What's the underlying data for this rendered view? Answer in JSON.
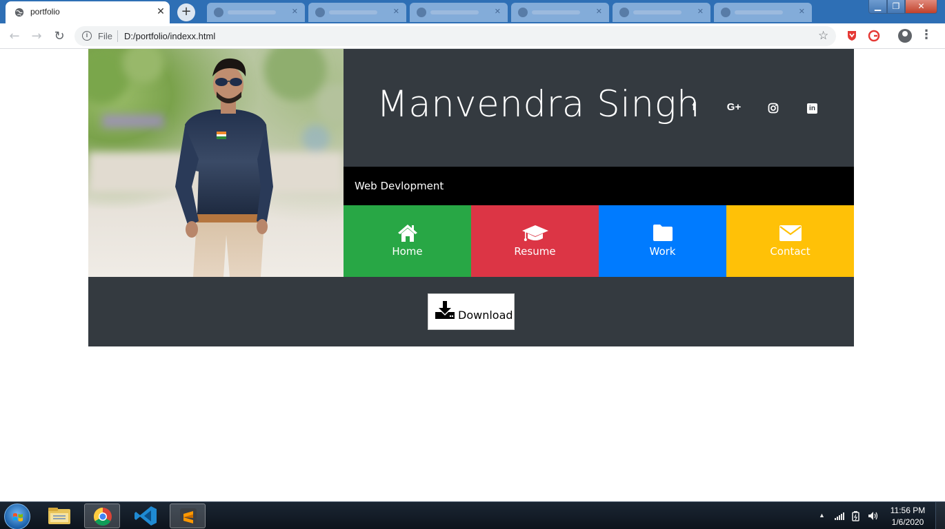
{
  "browser": {
    "active_tab": {
      "title": "portfolio",
      "close": "✕"
    },
    "new_tab": "+",
    "window_controls": {
      "minimize": "▁",
      "maximize": "❐",
      "close": "✕"
    },
    "address": {
      "scheme_label": "File",
      "url": "D:/portfolio/indexx.html",
      "info": "i"
    },
    "nav": {
      "back": "←",
      "forward": "→",
      "reload": "↻"
    },
    "bookmark_star": "☆",
    "menu": "⋮"
  },
  "page": {
    "name": "Manvendra Singh",
    "subtitle": "Web Devlopment",
    "social": [
      {
        "icon": "facebook-icon",
        "glyph": "f"
      },
      {
        "icon": "google-plus-icon",
        "glyph": "G+"
      },
      {
        "icon": "instagram-icon",
        "glyph": ""
      },
      {
        "icon": "linkedin-icon",
        "glyph": "in"
      }
    ],
    "tiles": [
      {
        "label": "Home",
        "icon": "home-icon",
        "color": "#28a745"
      },
      {
        "label": "Resume",
        "icon": "graduation-cap-icon",
        "color": "#dc3545"
      },
      {
        "label": "Work",
        "icon": "folder-icon",
        "color": "#007bff"
      },
      {
        "label": "Contact",
        "icon": "envelope-icon",
        "color": "#ffc107"
      }
    ],
    "download_label": "Download"
  },
  "taskbar": {
    "time": "11:56 PM",
    "date": "1/6/2020",
    "apps": [
      "file-explorer-icon",
      "chrome-icon",
      "vscode-icon",
      "sublime-text-icon"
    ]
  }
}
